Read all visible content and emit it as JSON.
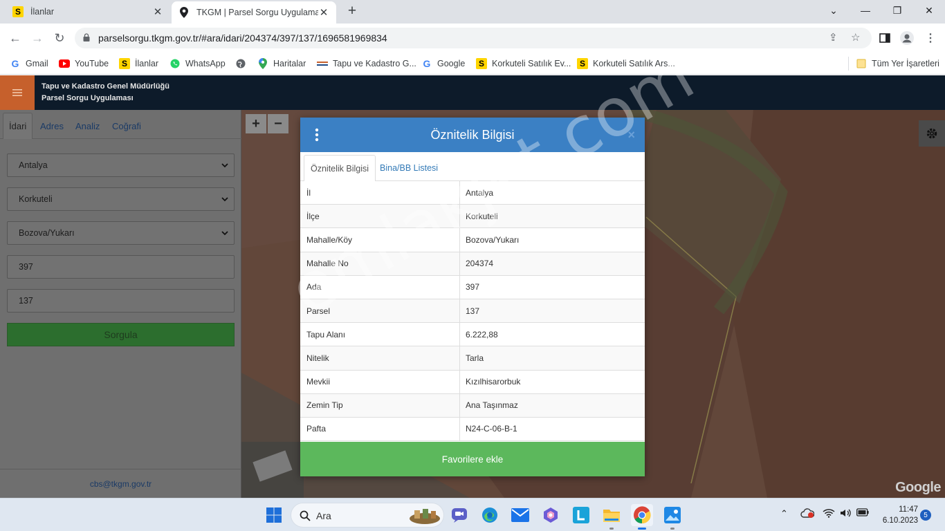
{
  "browser": {
    "tabs": [
      {
        "title": "İlanlar",
        "favicon": "s-badge-icon"
      },
      {
        "title": "TKGM | Parsel Sorgu Uygulaması",
        "favicon": "map-pin-icon"
      }
    ],
    "url": "parselsorgu.tkgm.gov.tr/#ara/idari/204374/397/137/1696581969834",
    "bookmarks": [
      {
        "label": "Gmail"
      },
      {
        "label": "YouTube"
      },
      {
        "label": "İlanlar"
      },
      {
        "label": "WhatsApp"
      },
      {
        "label": ""
      },
      {
        "label": "Haritalar"
      },
      {
        "label": "Tapu ve Kadastro G..."
      },
      {
        "label": "Google"
      },
      {
        "label": "Korkuteli Satılık Ev..."
      },
      {
        "label": "Korkuteli Satılık Ars..."
      }
    ],
    "bookmarks_all": "Tüm Yer İşaretleri"
  },
  "app": {
    "title_line1": "Tapu ve Kadastro Genel Müdürlüğü",
    "title_line2": "Parsel Sorgu Uygulaması",
    "accent_color": "#c6602c"
  },
  "sidebar": {
    "tabs": [
      "İdari",
      "Adres",
      "Analiz",
      "Coğrafi"
    ],
    "active_tab": "İdari",
    "il": "Antalya",
    "ilce": "Korkuteli",
    "mahalle": "Bozova/Yukarı",
    "ada": "397",
    "parsel": "137",
    "query_button": "Sorgula",
    "footer_email": "cbs@tkgm.gov.tr"
  },
  "modal": {
    "title": "Öznitelik Bilgisi",
    "close": "×",
    "tabs": [
      "Öznitelik Bilgisi",
      "Bina/BB Listesi"
    ],
    "rows": [
      {
        "key": "İl",
        "value": "Antalya"
      },
      {
        "key": "İlçe",
        "value": "Korkuteli"
      },
      {
        "key": "Mahalle/Köy",
        "value": "Bozova/Yukarı"
      },
      {
        "key": "Mahalle No",
        "value": "204374"
      },
      {
        "key": "Ada",
        "value": "397"
      },
      {
        "key": "Parsel",
        "value": "137"
      },
      {
        "key": "Tapu Alanı",
        "value": "6.222,88"
      },
      {
        "key": "Nitelik",
        "value": "Tarla"
      },
      {
        "key": "Mevkii",
        "value": "Kızılhisarorbuk"
      },
      {
        "key": "Zemin Tip",
        "value": "Ana Taşınmaz"
      },
      {
        "key": "Pafta",
        "value": "N24-C-06-B-1"
      }
    ],
    "favorite_button": "Favorilere ekle",
    "header_color": "#3b80c4",
    "favorite_color": "#5cb85c"
  },
  "map": {
    "google_logo": "Google"
  },
  "watermark": "emlakjet.com",
  "taskbar": {
    "search_text": "Ara",
    "time": "11:47",
    "date": "6.10.2023",
    "notifications": "5"
  }
}
